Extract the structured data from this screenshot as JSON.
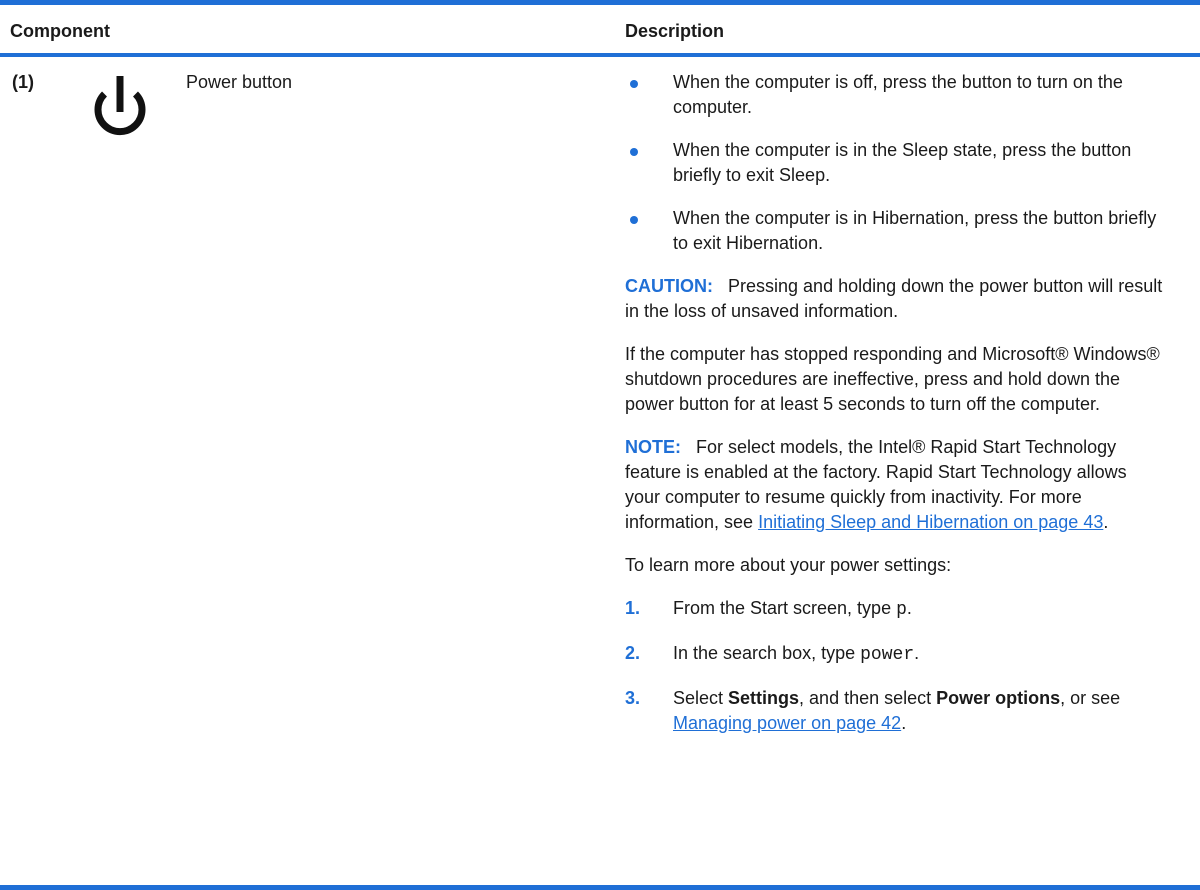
{
  "header": {
    "component_label": "Component",
    "description_label": "Description"
  },
  "row": {
    "number": "(1)",
    "icon": "power-icon",
    "name": "Power button"
  },
  "bullets": [
    "When the computer is off, press the button to turn on the computer.",
    "When the computer is in the Sleep state, press the button briefly to exit Sleep.",
    "When the computer is in Hibernation, press the button briefly to exit Hibernation."
  ],
  "caution": {
    "label": "CAUTION:",
    "text": "Pressing and holding down the power button will result in the loss of unsaved information."
  },
  "stopped_responding": "If the computer has stopped responding and Microsoft® Windows® shutdown procedures are ineffective, press and hold down the power button for at least 5 seconds to turn off the computer.",
  "note": {
    "label": "NOTE:",
    "text": "For select models, the Intel® Rapid Start Technology feature is enabled at the factory. Rapid Start Technology allows your computer to resume quickly from inactivity. For more information, see ",
    "link": "Initiating Sleep and Hibernation on page 43",
    "after": "."
  },
  "learn_more": "To learn more about your power settings:",
  "steps": [
    {
      "num": "1.",
      "pre": "From the Start screen, type ",
      "code": "p",
      "post": "."
    },
    {
      "num": "2.",
      "pre": "In the search box, type ",
      "code": "power",
      "post": "."
    },
    {
      "num": "3.",
      "pre": "Select ",
      "bold1": "Settings",
      "mid": ", and then select ",
      "bold2": "Power options",
      "mid2": ", or see ",
      "link": "Managing power on page 42",
      "post": "."
    }
  ],
  "colors": {
    "accent": "#1f6fd6",
    "text": "#1a1a1a"
  }
}
